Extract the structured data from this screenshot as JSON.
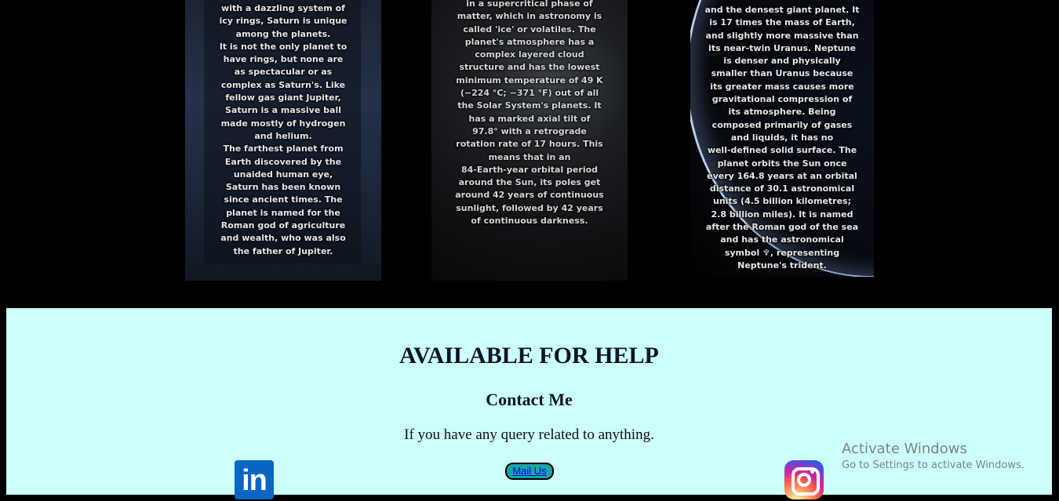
{
  "planets": {
    "saturn": {
      "text": "with a dazzling system of\nicy rings, Saturn is unique\namong the planets.\nIt is not the only planet to\nhave rings, but none are\nas spectacular or as\ncomplex as Saturn's. Like\nfellow gas giant Jupiter,\nSaturn is a massive ball\nmade mostly of hydrogen\nand helium.\nThe farthest planet from\nEarth discovered by the\nunaided human eye,\nSaturn has been known\nsince ancient times. The\nplanet is named for the\nRoman god of agriculture\nand wealth, who was also\nthe father of Jupiter."
    },
    "uranus": {
      "text": "in a supercritical phase of\nmatter, which in astronomy is\ncalled 'ice' or volatiles. The\nplanet's atmosphere has a\ncomplex layered cloud\nstructure and has the lowest\nminimum temperature of 49 K\n(−224 °C; −371 °F) out of all\nthe Solar System's planets. It\nhas a marked axial tilt of\n97.8° with a retrograde\nrotation rate of 17 hours. This\nmeans that in an\n84-Earth-year orbital period\naround the Sun, its poles get\naround 42 years of continuous\nsunlight, followed by 42 years\nof continuous darkness."
    },
    "neptune": {
      "text": "and the densest giant planet. It\nis 17 times the mass of Earth,\nand slightly more massive than\nits near-twin Uranus. Neptune\nis denser and physically\nsmaller than Uranus because\nits greater mass causes more\ngravitational compression of\nits atmosphere. Being\ncomposed primarily of gases\nand liquids, it has no\nwell-defined solid surface. The\nplanet orbits the Sun once\nevery 164.8 years at an orbital\ndistance of 30.1 astronomical\nunits (4.5 billion kilometres;\n2.8 billion miles). It is named\nafter the Roman god of the sea\nand has the astronomical\nsymbol ♆, representing\nNeptune's trident."
    }
  },
  "contact": {
    "heading": "AVAILABLE FOR HELP",
    "subheading": "Contact Me",
    "description": "If you have any query related to anything.",
    "mail_label": "Mail Us",
    "linkedin_glyph": "in"
  },
  "watermark": {
    "title": "Activate Windows",
    "subtitle": "Go to Settings to activate Windows."
  },
  "colors": {
    "contact_bg": "#ccfff9",
    "linkedin": "#0a66c2",
    "mail_button": "#1aa5a5"
  }
}
